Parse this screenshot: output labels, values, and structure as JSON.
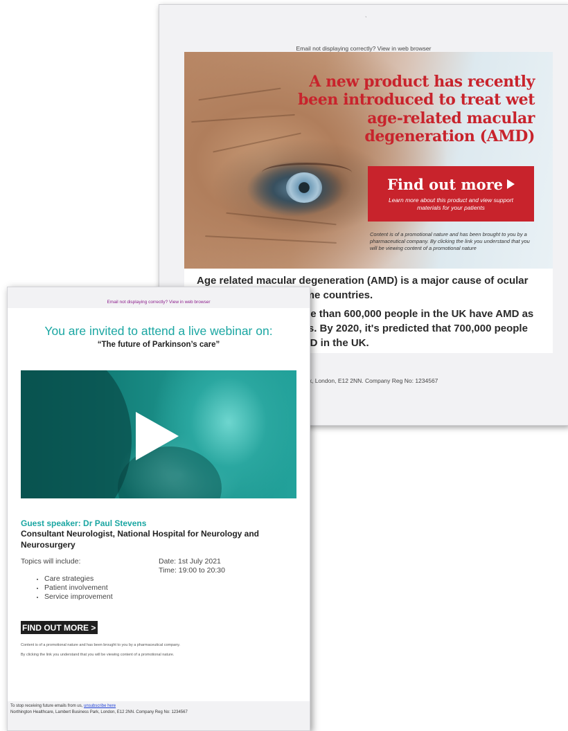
{
  "amd_email": {
    "view_link": "Email not displaying correctly? View in web browser",
    "mark": "`",
    "headline": "A new product has recently been introduced to treat wet age-related macular degeneration (AMD)",
    "cta_title": "Find out more",
    "cta_subtitle": "Learn more about this product and view support materials for your patients",
    "disclaimer": "Content is of a promotional nature and has been brought to you by a pharmaceutical company. By clicking the link you understand that you will be viewing content of a promotional nature",
    "para1": "Age related macular degeneration (AMD) is a major cause of ocular morbidity in high income countries.",
    "para2": "It is estimated that more than 600,000 people in the UK have AMD as the cause of vision loss. By 2020, it's predicted that 700,000 people will have late-stage AMD in the UK.",
    "footer": "Northington Healthcare, Lambert Business Park, London, E12 2NN. Company Reg No: 1234567"
  },
  "webinar_email": {
    "view_link": "Email not displaying correctly? View in web browser",
    "invite": "You are invited to attend a live webinar on:",
    "talk_title": "“The future of Parkinson’s care”",
    "speaker_label": "Guest speaker: Dr Paul Stevens",
    "speaker_role": "Consultant Neurologist, National Hospital for Neurology and Neurosurgery",
    "topics_heading": "Topics will include:",
    "date": "Date: 1st July 2021",
    "time": "Time: 19:00 to 20:30",
    "topics": [
      "Care strategies",
      "Patient involvement",
      "Service improvement"
    ],
    "cta": "FIND OUT MORE >",
    "fine_print_1": "Content is of a promotional nature and has been brought to you by a pharmaceutical company.",
    "fine_print_2": "By clicking the link you understand that you will be viewing content of a promotional nature.",
    "footer_prefix": "To stop receiving future emails from us, ",
    "unsubscribe": "unsubscribe here",
    "footer_address": "Northington Healthcare, Lambert Business Park, London, E12 2NN. Company Reg No: 1234567"
  },
  "icons": {
    "amd_cta": "play-triangle-icon",
    "video": "play-icon"
  },
  "colors": {
    "amd_red": "#c8232c",
    "webinar_teal": "#1aa6a2",
    "cta_dark": "#1f1f1f",
    "link_blue": "#1d3fd6"
  }
}
